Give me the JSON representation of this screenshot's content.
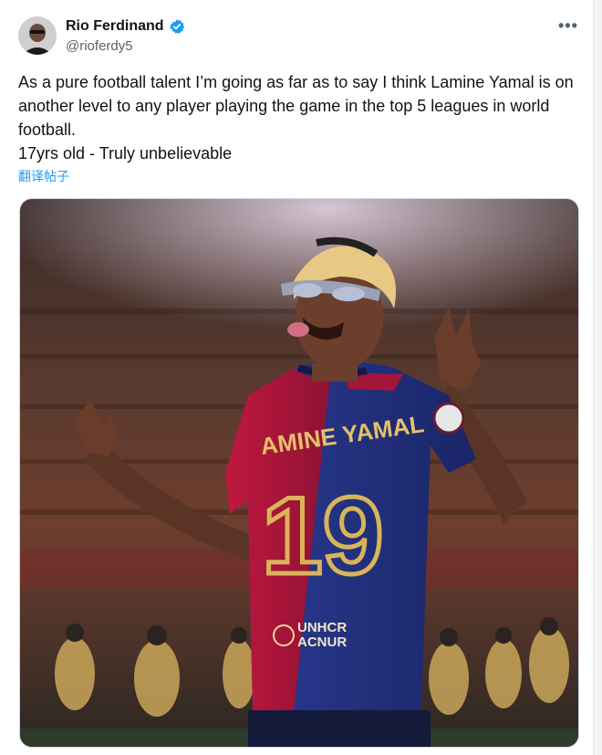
{
  "author": {
    "name": "Rio Ferdinand",
    "handle": "@rioferdy5"
  },
  "menu_icon": "more-horizontal-icon",
  "tweet": {
    "line1": "As a pure football talent I’m going as far as to say I think Lamine Yamal is on another level to any player playing the game in the top 5 leagues in world football.",
    "line2": "17yrs old - Truly unbelievable",
    "translate": "翻译帖子"
  },
  "media": {
    "jersey_name": "AMINE YAMAL",
    "jersey_number": "19",
    "sponsor_line1": "UNHCR",
    "sponsor_line2": "ACNUR"
  },
  "colors": {
    "accent": "#1d9bf0",
    "blaugrana_blue": "#1f2f7a",
    "blaugrana_red": "#a3153a",
    "gold": "#d9b45a"
  }
}
